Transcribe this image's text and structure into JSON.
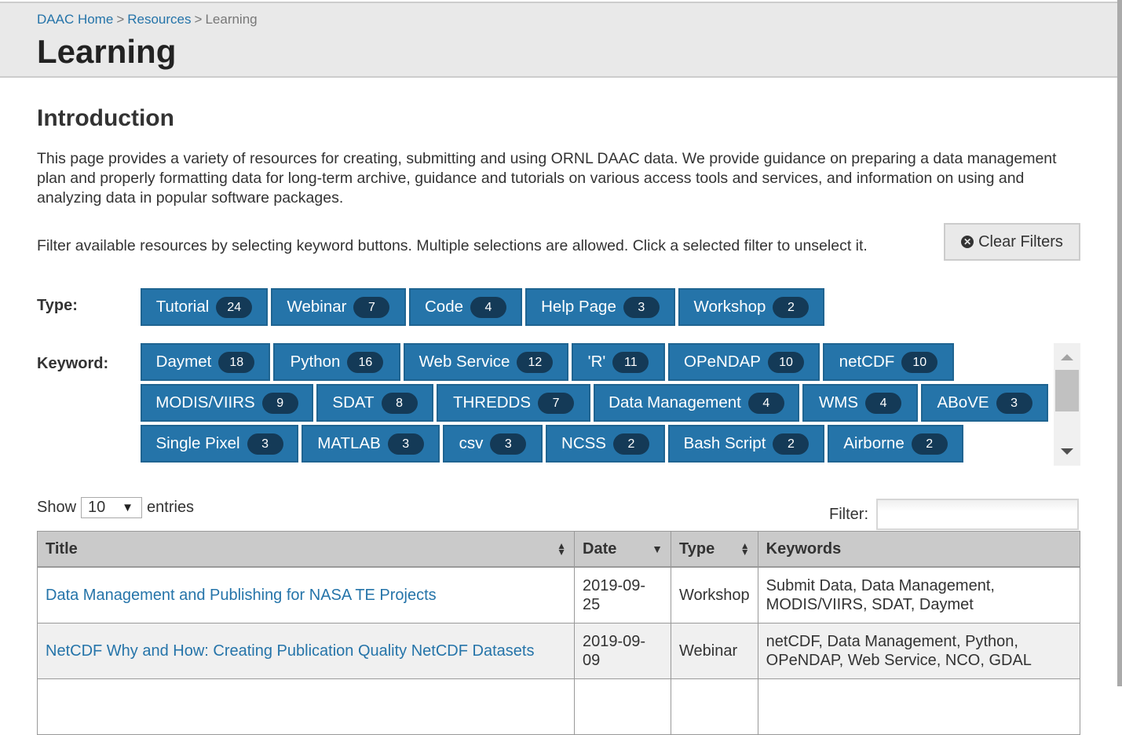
{
  "breadcrumb": {
    "items": [
      {
        "label": "DAAC Home",
        "link": true
      },
      {
        "label": "Resources",
        "link": true
      },
      {
        "label": "Learning",
        "link": false
      }
    ],
    "separator": ">"
  },
  "page": {
    "title": "Learning"
  },
  "intro": {
    "heading": "Introduction",
    "text": "This page provides a variety of resources for creating, submitting and using ORNL DAAC data. We provide guidance on preparing a data management plan and properly formatting data for long-term archive, guidance and tutorials on various access tools and services, and information on using and analyzing data in popular software packages."
  },
  "filters": {
    "instructions": "Filter available resources by selecting keyword buttons. Multiple selections are allowed. Click a selected filter to unselect it.",
    "clear_label": "Clear Filters",
    "clear_icon": "times-circle-icon",
    "type_label": "Type:",
    "keyword_label": "Keyword:",
    "types": [
      {
        "label": "Tutorial",
        "count": "24"
      },
      {
        "label": "Webinar",
        "count": "7"
      },
      {
        "label": "Code",
        "count": "4"
      },
      {
        "label": "Help Page",
        "count": "3"
      },
      {
        "label": "Workshop",
        "count": "2"
      }
    ],
    "keywords": [
      {
        "label": "Daymet",
        "count": "18"
      },
      {
        "label": "Python",
        "count": "16"
      },
      {
        "label": "Web Service",
        "count": "12"
      },
      {
        "label": "'R'",
        "count": "11"
      },
      {
        "label": "OPeNDAP",
        "count": "10"
      },
      {
        "label": "netCDF",
        "count": "10"
      },
      {
        "label": "MODIS/VIIRS",
        "count": "9"
      },
      {
        "label": "SDAT",
        "count": "8"
      },
      {
        "label": "THREDDS",
        "count": "7"
      },
      {
        "label": "Data Management",
        "count": "4"
      },
      {
        "label": "WMS",
        "count": "4"
      },
      {
        "label": "ABoVE",
        "count": "3"
      },
      {
        "label": "Single Pixel",
        "count": "3"
      },
      {
        "label": "MATLAB",
        "count": "3"
      },
      {
        "label": "csv",
        "count": "3"
      },
      {
        "label": "NCSS",
        "count": "2"
      },
      {
        "label": "Bash Script",
        "count": "2"
      },
      {
        "label": "Airborne",
        "count": "2"
      }
    ]
  },
  "table_controls": {
    "show_label": "Show",
    "entries_label": "entries",
    "page_length": "10",
    "filter_label": "Filter:",
    "filter_value": ""
  },
  "table": {
    "columns": [
      {
        "label": "Title",
        "sort": "both"
      },
      {
        "label": "Date",
        "sort": "desc"
      },
      {
        "label": "Type",
        "sort": "both"
      },
      {
        "label": "Keywords",
        "sort": "none"
      }
    ],
    "rows": [
      {
        "title": "Data Management and Publishing for NASA TE Projects",
        "date": "2019-09-25",
        "type": "Workshop",
        "keywords": "Submit Data, Data Management, MODIS/VIIRS, SDAT, Daymet"
      },
      {
        "title": "NetCDF Why and How: Creating Publication Quality NetCDF Datasets",
        "date": "2019-09-09",
        "type": "Webinar",
        "keywords": "netCDF, Data Management, Python, OPeNDAP, Web Service, NCO, GDAL"
      }
    ]
  },
  "colors": {
    "button_bg": "#2574a9",
    "badge_bg": "#143a57",
    "link": "#2574a9",
    "header_bg": "#e9e9e9"
  }
}
